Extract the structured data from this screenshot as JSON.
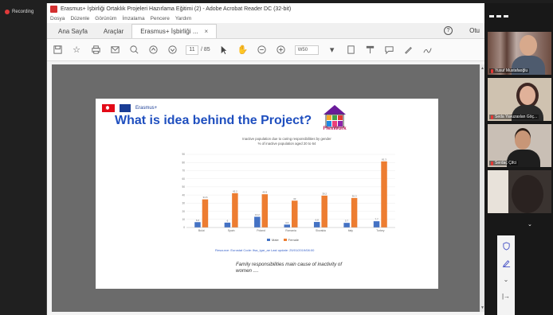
{
  "recording": {
    "label": "Recording"
  },
  "window": {
    "title": "Erasmus+ İşbirliği Ortaklık Projeleri Hazırlama Eğitimi (2) - Adobe Acrobat Reader DC (32-bit)"
  },
  "menu": [
    "Dosya",
    "Düzenle",
    "Görünüm",
    "İmzalama",
    "Pencere",
    "Yardım"
  ],
  "tabs": {
    "home": "Ana Sayfa",
    "tools": "Araçlar",
    "doc": "Erasmus+ İşbirliği ..."
  },
  "account": {
    "signin": "Otu"
  },
  "toolbar": {
    "page_current": "11",
    "page_total": "/ 85",
    "zoom": "W50"
  },
  "slide": {
    "erasmus_label": "Erasmus+",
    "title": "What is idea behind the Project?",
    "logo_text": "FlexWork",
    "source": "Resource: Eurostat Code: lfsa_igar_ae   Last update: 25/01/2019/08:00",
    "caption": "Family responsibilities main cause of inactivity of women ...."
  },
  "chart_data": {
    "type": "bar",
    "title": "Inactive population due to caring responsibilities by gender\n% of inactive population aged 20 to 64",
    "categories": [
      "Bulut",
      "Spain",
      "Poland",
      "Romania",
      "Slovakia",
      "Italy",
      "Turkey"
    ],
    "series": [
      {
        "name": "Male",
        "color": "#4472c4",
        "values": [
          6.6,
          6.0,
          13.2,
          3.6,
          6.8,
          5.7,
          7.7
        ]
      },
      {
        "name": "Female",
        "color": "#ed7d31",
        "values": [
          34.6,
          42.2,
          40.9,
          33.0,
          39.2,
          36.3,
          81.3
        ]
      }
    ],
    "ylim": [
      0,
      90
    ],
    "yticks": [
      0,
      10,
      20,
      30,
      40,
      50,
      60,
      70,
      80,
      90
    ]
  },
  "participants": [
    {
      "name": "Yusuf Mustafaoğlu"
    },
    {
      "name": "Seda Yavuzaslan Göç..."
    },
    {
      "name": "Serdaç Çifci"
    },
    {
      "name": ""
    }
  ]
}
